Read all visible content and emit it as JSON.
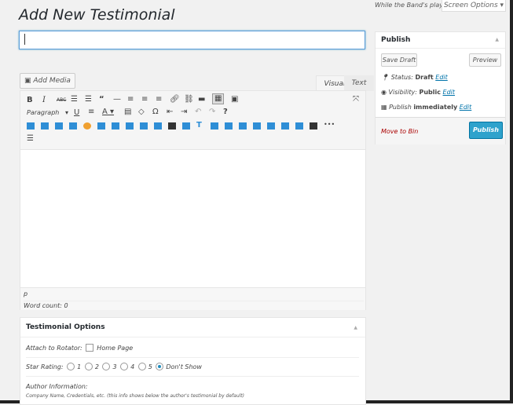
{
  "header": {
    "top_note": "While the Band's playin'",
    "screen_options": "Screen Options",
    "page_title": "Add New Testimonial"
  },
  "title_input": {
    "value": ""
  },
  "editor": {
    "add_media": "Add Media",
    "tab_visual": "Visual",
    "tab_text": "Text",
    "format_select": "Paragraph",
    "path": "p",
    "word_count": "Word count: 0",
    "toolbar_row1": [
      "B",
      "I",
      "ABC",
      "•",
      "1.",
      "“",
      "—",
      "≡",
      "≡",
      "≡",
      "⚲",
      "⚲",
      "▬",
      "▦",
      "▣"
    ],
    "toolbar_row2": [
      "U",
      "≡",
      "A",
      "▼",
      "▤",
      "◇",
      "Ω",
      "⇤",
      "⇥",
      "↶",
      "↷",
      "?"
    ]
  },
  "publish": {
    "title": "Publish",
    "save_draft": "Save Draft",
    "preview": "Preview",
    "status_label": "Status:",
    "status_value": "Draft",
    "visibility_label": "Visibility:",
    "visibility_value": "Public",
    "publish_label": "Publish",
    "publish_value": "immediately",
    "edit": "Edit",
    "move_to_bin": "Move to Bin",
    "publish_button": "Publish"
  },
  "testimonial": {
    "title": "Testimonial Options",
    "attach_label": "Attach to Rotator:",
    "attach_option": "Home Page",
    "star_label": "Star Rating:",
    "star_options": [
      "1",
      "2",
      "3",
      "4",
      "5",
      "Don't Show"
    ],
    "star_selected": "Don't Show",
    "author_label": "Author Information:",
    "author_hint": "Company Name, Credentials, etc. (this info shows below the author's testimonial by default)"
  },
  "colors": {
    "primary": "#2ea2cc",
    "link": "#0073aa",
    "danger": "#a00000"
  }
}
